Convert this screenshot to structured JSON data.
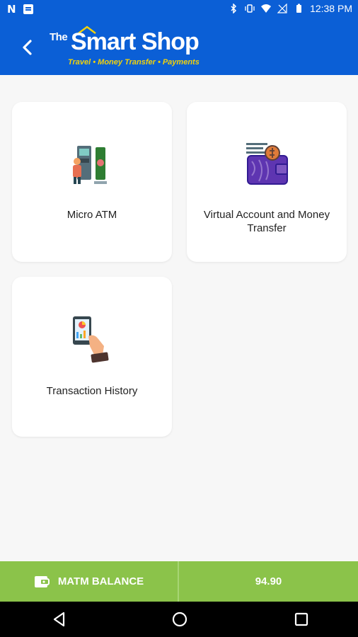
{
  "status_bar": {
    "time": "12:38 PM",
    "left_icons": [
      "n-notification-icon",
      "message-icon"
    ],
    "right_icons": [
      "bluetooth-icon",
      "vibrate-icon",
      "wifi-icon",
      "signal-icon",
      "battery-icon"
    ]
  },
  "app_bar": {
    "back_icon": "chevron-left-icon",
    "logo": {
      "prefix": "The",
      "name": "Smart Shop",
      "tagline": "Travel • Money Transfer • Payments"
    },
    "colors": {
      "background": "#0b5fd6",
      "tagline": "#f2d20a"
    }
  },
  "services": [
    {
      "label": "Micro ATM",
      "icon": "atm-machine-icon"
    },
    {
      "label": "Virtual Account and Money Transfer",
      "icon": "wallet-transfer-icon"
    },
    {
      "label": "Transaction History",
      "icon": "tablet-report-icon"
    }
  ],
  "balance_bar": {
    "label": "MATM BALANCE",
    "value": "94.90",
    "icon": "wallet-icon",
    "color": "#8bc34a"
  },
  "nav_bar": {
    "buttons": [
      "nav-back-icon",
      "nav-home-icon",
      "nav-recents-icon"
    ]
  }
}
